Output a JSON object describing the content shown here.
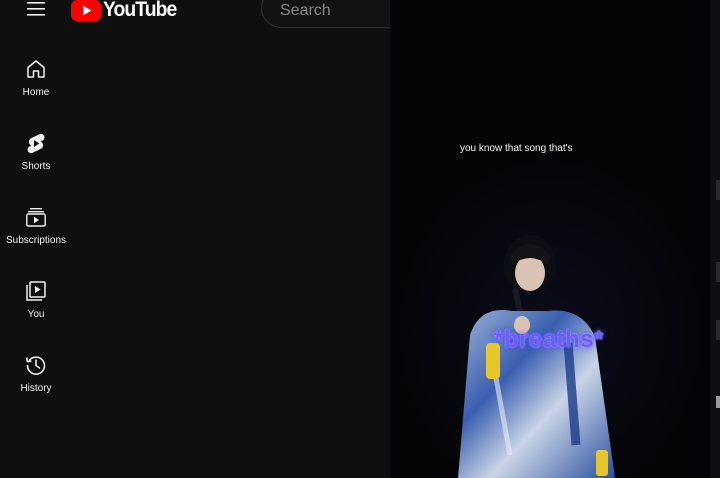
{
  "header": {
    "logo_text": "YouTube",
    "search_placeholder": "Search"
  },
  "sidebar": {
    "items": [
      {
        "label": "Home",
        "icon": "home-icon"
      },
      {
        "label": "Shorts",
        "icon": "shorts-icon"
      },
      {
        "label": "Subscriptions",
        "icon": "subscriptions-icon"
      },
      {
        "label": "You",
        "icon": "you-icon"
      },
      {
        "label": "History",
        "icon": "history-icon"
      }
    ]
  },
  "player": {
    "caption_top": "you know that song that's",
    "caption_overlay": "*breaths*"
  },
  "colors": {
    "background": "#0f0f0f",
    "brand_red": "#ff0000",
    "caption_overlay": "#6a5cff"
  }
}
